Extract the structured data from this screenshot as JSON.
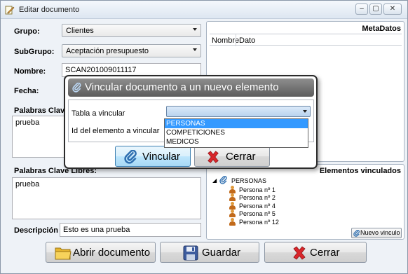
{
  "window": {
    "title": "Editar documento",
    "controls": {
      "minimize": "–",
      "maximize": "▢",
      "close": "✕"
    }
  },
  "form": {
    "grupo_label": "Grupo:",
    "grupo_value": "Clientes",
    "subgrupo_label": "SubGrupo:",
    "subgrupo_value": "Aceptación presupuesto",
    "nombre_label": "Nombre:",
    "nombre_value": "SCAN201009011117",
    "fecha_label": "Fecha:",
    "palabras_clave_label": "Palabras Clave",
    "palabras_clave_value": "prueba",
    "palabras_libres_label": "Palabras Clave Libres:",
    "palabras_libres_value": "prueba",
    "descripcion_label": "Descripción :",
    "descripcion_value": "Esto es una prueba"
  },
  "metadatos": {
    "title": "MetaDatos",
    "columns": [
      "Nombre",
      "Dato"
    ]
  },
  "vinculados": {
    "title": "Elementos vinculados",
    "root": "PERSONAS",
    "items": [
      "Persona nº 1",
      "Persona nº 2",
      "Persona nº 4",
      "Persona nº 5",
      "Persona nº 12"
    ],
    "new_link_button": "Nuevo vinculo"
  },
  "buttons": {
    "abrir": "Abrir documento",
    "guardar": "Guardar",
    "cerrar": "Cerrar"
  },
  "dialog": {
    "title": "Vincular documento a un nuevo elemento",
    "tabla_label": "Tabla a vincular",
    "id_label": "Id del elemento a vincular",
    "options": [
      "PERSONAS",
      "COMPETICIONES",
      "MEDICOS"
    ],
    "selected_option": "PERSONAS",
    "vincular_button": "Vincular",
    "cerrar_button": "Cerrar"
  },
  "colors": {
    "accent": "#3399ff",
    "dialog_header": "#6e6e6e",
    "close_red": "#d9262b"
  }
}
